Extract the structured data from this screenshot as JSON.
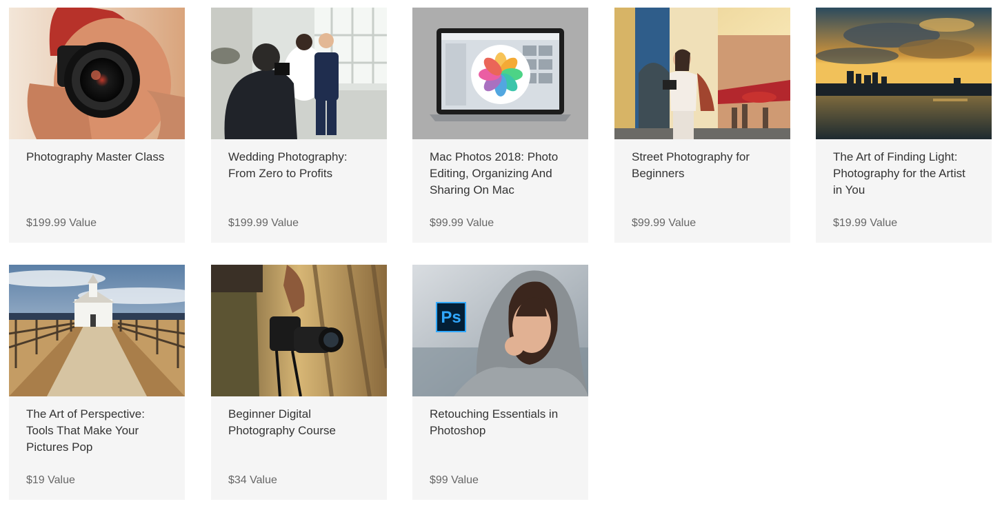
{
  "bundle": {
    "courses": [
      {
        "title": "Photography Master Class",
        "value": "$199.99 Value",
        "image": "photographer-holding-camera"
      },
      {
        "title": "Wedding Photography: From Zero to Profits",
        "value": "$199.99 Value",
        "image": "wedding-photographer-with-couple"
      },
      {
        "title": "Mac Photos 2018: Photo Editing, Organizing And Sharing On Mac",
        "value": "$99.99 Value",
        "image": "macbook-photos-app-logo"
      },
      {
        "title": "Street Photography for Beginners",
        "value": "$99.99 Value",
        "image": "woman-taking-street-photo"
      },
      {
        "title": "The Art of Finding Light: Photography for the Artist in You",
        "value": "$19.99 Value",
        "image": "sunset-city-lake"
      },
      {
        "title": "The Art of Perspective: Tools That Make Your Pictures Pop",
        "value": "$19 Value",
        "image": "church-path-fences"
      },
      {
        "title": "Beginner Digital Photography Course",
        "value": "$34 Value",
        "image": "hand-holding-dslr"
      },
      {
        "title": "Retouching Essentials in Photoshop",
        "value": "$99 Value",
        "image": "woman-portrait-photoshop-badge",
        "badge": "Ps"
      }
    ]
  }
}
